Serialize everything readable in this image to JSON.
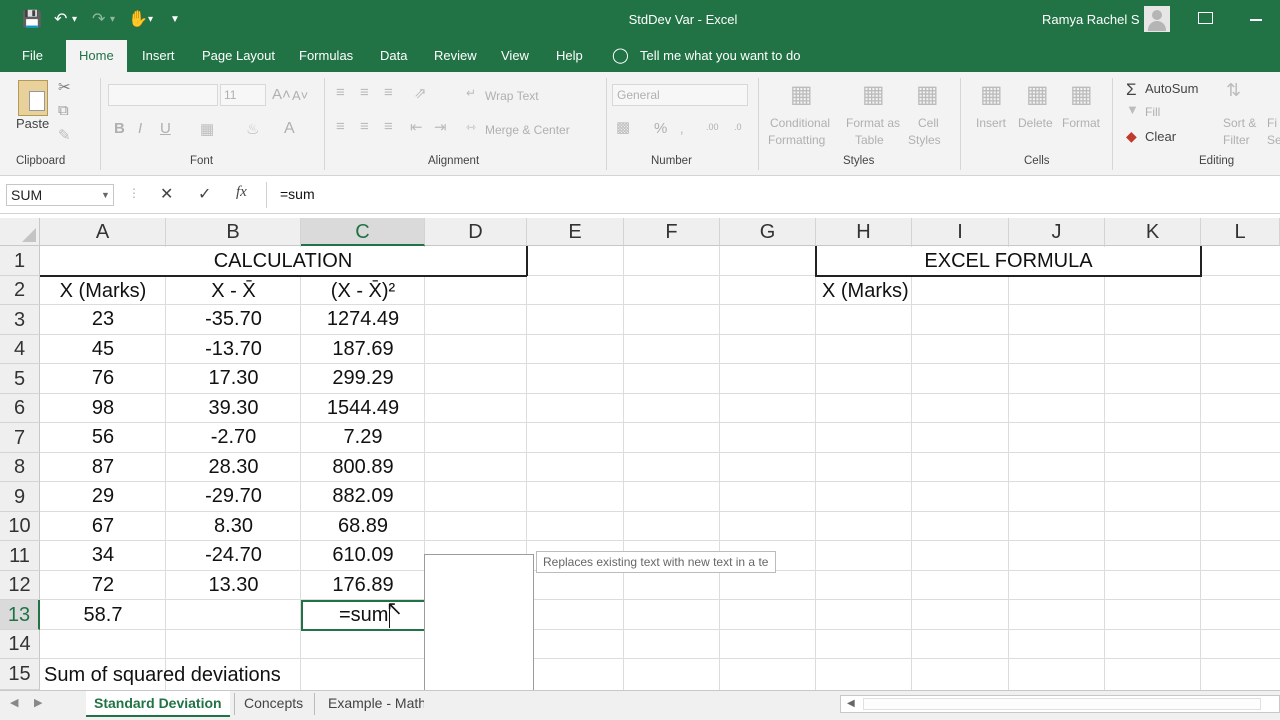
{
  "window": {
    "title": "StdDev Var  -  Excel",
    "user": "Ramya Rachel S"
  },
  "quick_access": {
    "save_icon": "save-icon",
    "undo_icon": "undo-icon",
    "redo_icon": "redo-icon",
    "touch_icon": "touch-mode-icon",
    "customize_icon": "customize-qat-icon"
  },
  "tabs": [
    "File",
    "Home",
    "Insert",
    "Page Layout",
    "Formulas",
    "Data",
    "Review",
    "View",
    "Help"
  ],
  "tell_me": "Tell me what you want to do",
  "ribbon": {
    "clipboard": {
      "paste": "Paste",
      "group": "Clipboard"
    },
    "font": {
      "size": "11",
      "bold": "B",
      "italic": "I",
      "underline": "U",
      "grow": "A˄",
      "shrink": "A˅",
      "color": "A",
      "group": "Font"
    },
    "alignment": {
      "wrap": "Wrap Text",
      "merge": "Merge & Center",
      "group": "Alignment"
    },
    "number": {
      "format": "General",
      "percent": "%",
      "group": "Number"
    },
    "styles": {
      "conditional_1": "Conditional",
      "conditional_2": "Formatting",
      "format_table_1": "Format as",
      "format_table_2": "Table",
      "cell_styles_1": "Cell",
      "cell_styles_2": "Styles",
      "group": "Styles"
    },
    "cells": {
      "insert": "Insert",
      "delete": "Delete",
      "format": "Format",
      "group": "Cells"
    },
    "editing": {
      "autosum": "AutoSum",
      "fill": "Fill",
      "clear": "Clear",
      "sort_1": "Sort &",
      "sort_2": "Filter",
      "find_1": "Fi",
      "find_2": "Se",
      "group": "Editing"
    }
  },
  "formula_bar": {
    "name_box": "SUM",
    "fx": "fx",
    "cancel": "✕",
    "enter": "✓",
    "formula": "=sum"
  },
  "columns": [
    "A",
    "B",
    "C",
    "D",
    "E",
    "F",
    "G",
    "H",
    "I",
    "J",
    "K",
    "L"
  ],
  "rows": [
    "1",
    "2",
    "3",
    "4",
    "5",
    "6",
    "7",
    "8",
    "9",
    "10",
    "11",
    "12",
    "13",
    "14",
    "15"
  ],
  "sheet": {
    "title_calc": "CALCULATION",
    "title_excel": "EXCEL FORMULA",
    "headers": [
      "X (Marks)",
      "X - X̄",
      "(X - X̄)²"
    ],
    "h2": "X (Marks)",
    "data": [
      [
        "23",
        "-35.70",
        "1274.49"
      ],
      [
        "45",
        "-13.70",
        "187.69"
      ],
      [
        "76",
        "17.30",
        "299.29"
      ],
      [
        "98",
        "39.30",
        "1544.49"
      ],
      [
        "56",
        "-2.70",
        "7.29"
      ],
      [
        "87",
        "28.30",
        "800.89"
      ],
      [
        "29",
        "-29.70",
        "882.09"
      ],
      [
        "67",
        "8.30",
        "68.89"
      ],
      [
        "34",
        "-24.70",
        "610.09"
      ],
      [
        "72",
        "13.30",
        "176.89"
      ]
    ],
    "mean": "58.7",
    "editing_cell": "=sum",
    "a15": "Sum of squared deviations"
  },
  "tooltip": "Replaces existing text with new text in a te",
  "sheet_tabs": [
    "Standard Deviation",
    "Concepts",
    "Example - Math"
  ],
  "colors": {
    "excel_green": "#217346",
    "ribbon_bg": "#f3f3f3"
  }
}
